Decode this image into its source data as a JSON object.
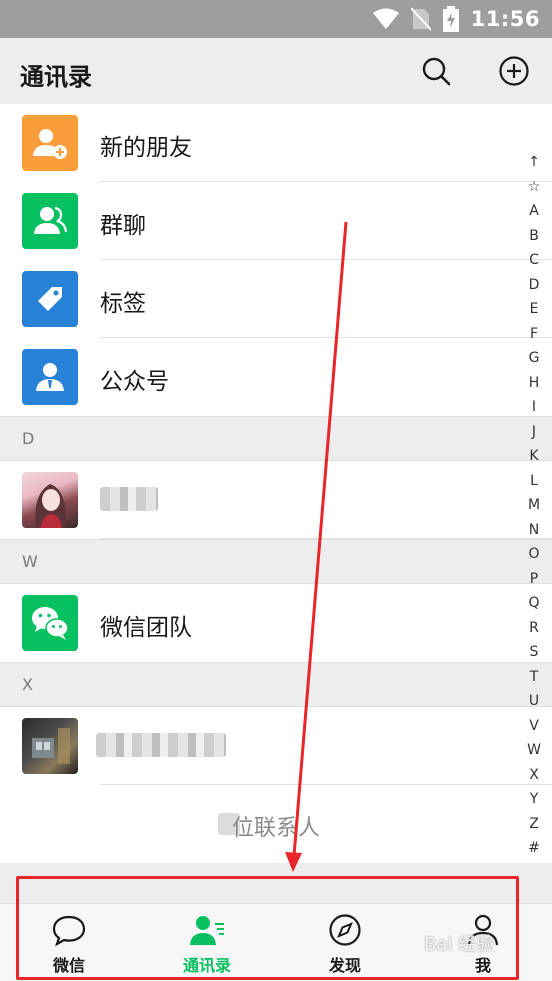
{
  "status_bar": {
    "time": "11:56"
  },
  "header": {
    "title": "通讯录"
  },
  "features": [
    {
      "label": "新的朋友",
      "color": "#fa9d3b",
      "icon": "add-friend-icon"
    },
    {
      "label": "群聊",
      "color": "#07c160",
      "icon": "group-chat-icon"
    },
    {
      "label": "标签",
      "color": "#2782d7",
      "icon": "tag-icon"
    },
    {
      "label": "公众号",
      "color": "#2782d7",
      "icon": "official-account-icon"
    }
  ],
  "sections": {
    "d": {
      "letter": "D"
    },
    "w": {
      "letter": "W",
      "contact": "微信团队"
    },
    "x": {
      "letter": "X"
    }
  },
  "contact_count": "位联系人",
  "index_letters": [
    "↑",
    "☆",
    "A",
    "B",
    "C",
    "D",
    "E",
    "F",
    "G",
    "H",
    "I",
    "J",
    "K",
    "L",
    "M",
    "N",
    "O",
    "P",
    "Q",
    "R",
    "S",
    "T",
    "U",
    "V",
    "W",
    "X",
    "Y",
    "Z",
    "#"
  ],
  "tabs": [
    {
      "label": "微信",
      "icon": "chat-bubble-icon",
      "active": false
    },
    {
      "label": "通讯录",
      "icon": "contacts-icon",
      "active": true
    },
    {
      "label": "发现",
      "icon": "compass-icon",
      "active": false
    },
    {
      "label": "我",
      "icon": "profile-icon",
      "active": false
    }
  ],
  "watermark": "Bai 经验",
  "colors": {
    "accent": "#07c160",
    "annotation": "#e8262a"
  }
}
